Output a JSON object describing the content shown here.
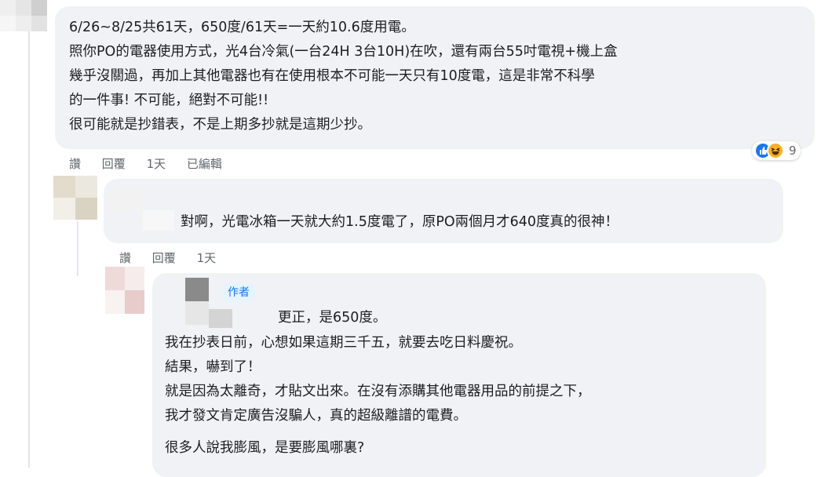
{
  "comments": [
    {
      "lines": [
        "6/26~8/25共61天，650度/61天=一天約10.6度用電。",
        "照你PO的電器使用方式，光4台冷氣(一台24H 3台10H)在吹，還有兩台55吋電視+機上盒",
        "幾乎沒關過，再加上其他電器也有在使用根本不可能一天只有10度電，這是非常不科學",
        "的一件事! 不可能，絕對不可能!!",
        "很可能就是抄錯表，不是上期多抄就是這期少抄。"
      ],
      "actions": {
        "like": "讚",
        "reply": "回覆",
        "time": "1天",
        "edited": "已編輯"
      },
      "reactions": {
        "count": "9",
        "icons": [
          "like-icon",
          "haha-icon"
        ]
      }
    },
    {
      "lines": [
        "對啊，光電冰箱一天就大約1.5度電了，原PO兩個月才640度真的很神！"
      ],
      "actions": {
        "like": "讚",
        "reply": "回覆",
        "time": "1天"
      }
    },
    {
      "badge": "作者",
      "lines": [
        "更正，是650度。",
        "我在抄表日前，心想如果這期三千五，就要去吃日料慶祝。",
        "結果，嚇到了！",
        "就是因為太離奇，才貼文出來。在沒有添購其他電器用品的前提之下，",
        "我才發文肯定廣告沒騙人，真的超級離譜的電費。",
        "很多人說我膨風，是要膨風哪裏?"
      ]
    }
  ],
  "colors": {
    "bubble": "#f0f2f5",
    "link": "#1877f2",
    "meta": "#65676b"
  }
}
